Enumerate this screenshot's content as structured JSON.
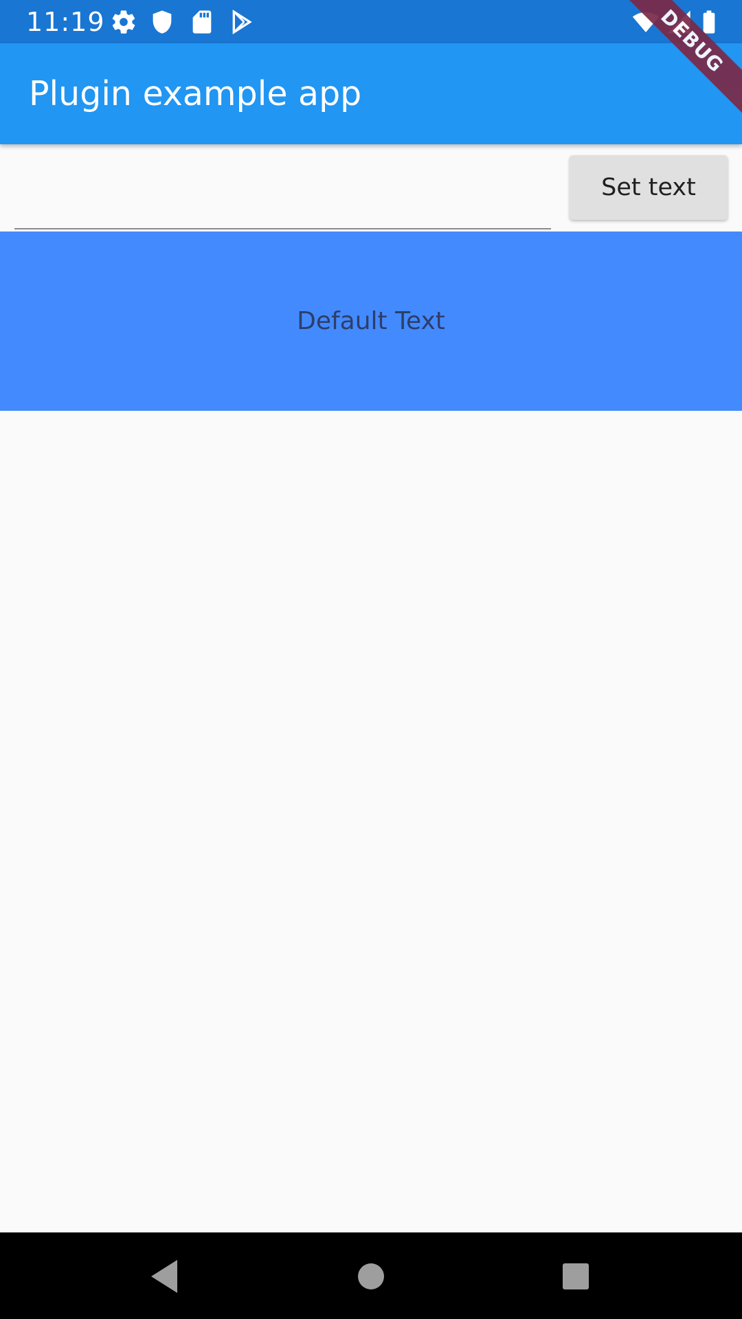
{
  "status_bar": {
    "time": "11:19",
    "left_icons": [
      "gear-icon",
      "shield-icon",
      "sd-card-icon",
      "play-store-icon"
    ],
    "right_icons": [
      "wifi-icon",
      "signal-icon",
      "battery-icon"
    ]
  },
  "app_bar": {
    "title": "Plugin example app"
  },
  "debug_banner": {
    "label": "DEBUG"
  },
  "input_row": {
    "text_field_value": "",
    "button_label": "Set text"
  },
  "native_view": {
    "text": "Default Text"
  },
  "nav_bar": {
    "buttons": [
      "back-icon",
      "home-icon",
      "recents-icon"
    ]
  },
  "colors": {
    "status_bar": "#1976d2",
    "app_bar": "#2196f3",
    "native_view": "#448aff",
    "background": "#fafafa",
    "button": "#e0e0e0",
    "debug_banner": "#7a2a48"
  }
}
